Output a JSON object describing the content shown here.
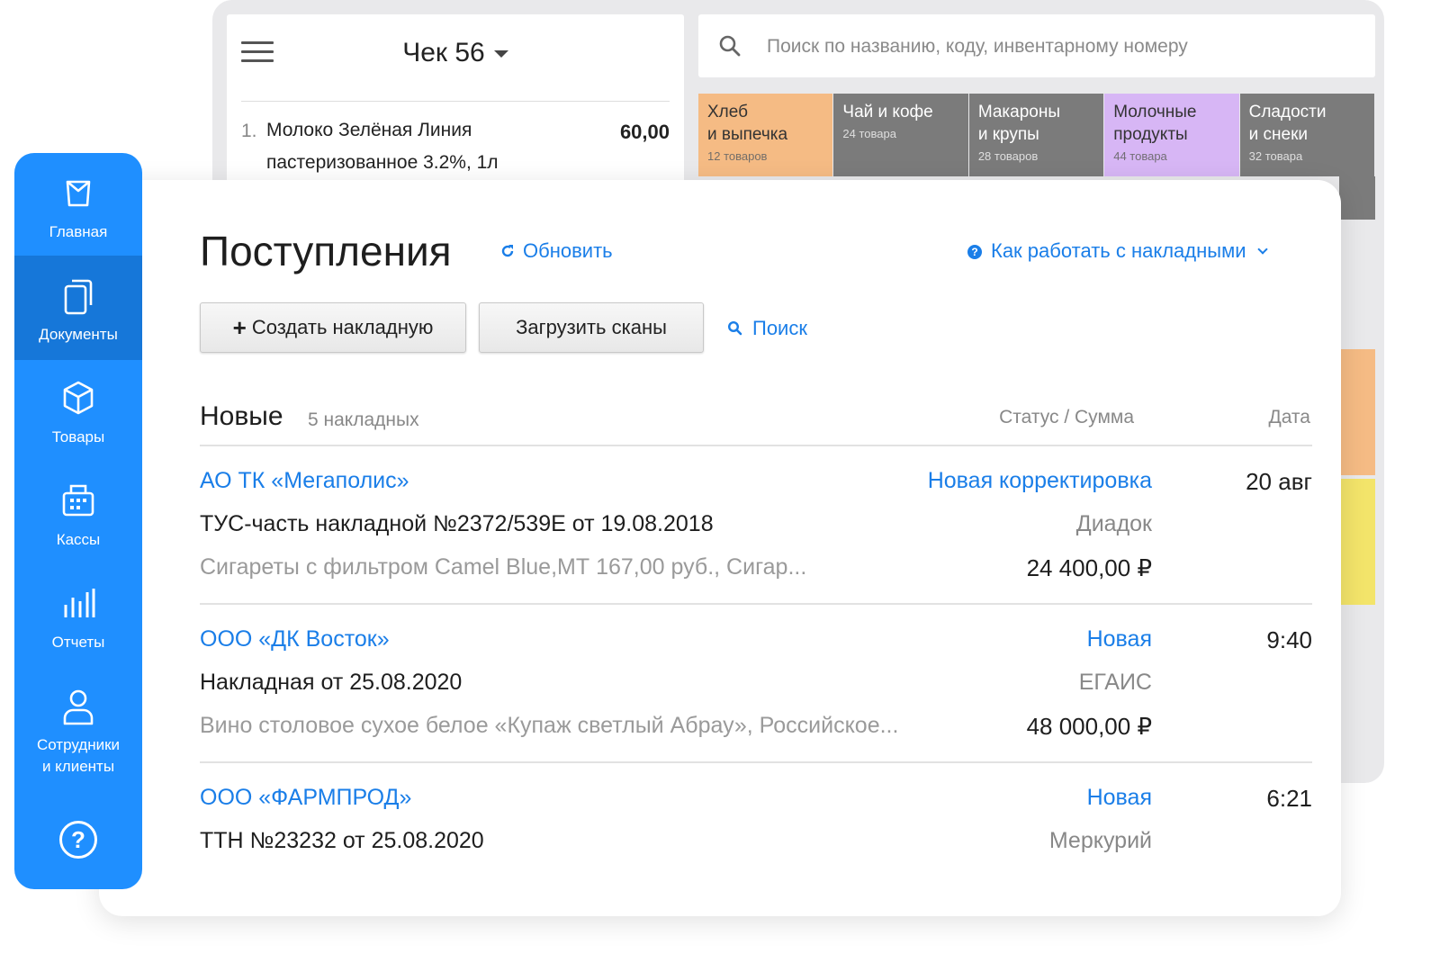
{
  "pos": {
    "check_title": "Чек 56",
    "receipt_item": {
      "num": "1.",
      "name": "Молоко Зелёная Линия пастеризованное 3.2%, 1л",
      "price": "60,00"
    },
    "search_placeholder": "Поиск по названию, коду, инвентарному номеру",
    "categories": [
      {
        "name": "Хлеб\nи выпечка",
        "count": "12 товаров",
        "color": "#f5bb84"
      },
      {
        "name": "Чай и кофе",
        "count": "24 товара",
        "color": "#7b7b7b"
      },
      {
        "name": "Макароны\nи крупы",
        "count": "28 товаров",
        "color": "#7b7b7b"
      },
      {
        "name": "Молочные\nпродукты",
        "count": "44 товара",
        "color": "#d7b6f5"
      },
      {
        "name": "Сладости\nи снеки",
        "count": "32 товара",
        "color": "#7b7b7b"
      }
    ],
    "strip_colors": [
      "#7b7b7b",
      "#f5bb84",
      "#f3e46a"
    ]
  },
  "sidebar": {
    "items": [
      {
        "label": "Главная",
        "icon": "bag-icon"
      },
      {
        "label": "Документы",
        "icon": "documents-icon",
        "active": true
      },
      {
        "label": "Товары",
        "icon": "box-icon"
      },
      {
        "label": "Кассы",
        "icon": "register-icon"
      },
      {
        "label": "Отчеты",
        "icon": "bar-chart-icon"
      },
      {
        "label": "Сотрудники\nи клиенты",
        "icon": "person-icon"
      }
    ],
    "help": "?"
  },
  "main": {
    "title": "Поступления",
    "refresh_label": "Обновить",
    "howto_label": "Как работать с накладными",
    "create_label": "Создать накладную",
    "upload_label": "Загрузить сканы",
    "search_label": "Поиск",
    "list_title": "Новые",
    "list_count": "5 накладных",
    "col_status": "Статус / Сумма",
    "col_date": "Дата",
    "rows": [
      {
        "supplier": "АО ТК «Мегаполис»",
        "status": "Новая корректировка",
        "date": "20 авг",
        "doc": "ТУС-часть накладной №2372/539Е от 19.08.2018",
        "source": "Диадок",
        "items": "Сигареты с фильтром Camel Blue,МТ 167,00 руб., Сигар...",
        "sum": "24 400,00 ₽"
      },
      {
        "supplier": "ООО «ДК Восток»",
        "status": "Новая",
        "date": "9:40",
        "doc": "Накладная от 25.08.2020",
        "source": "ЕГАИС",
        "items": "Вино столовое сухое белое «Купаж светлый Абрау», Российское...",
        "sum": "48 000,00 ₽"
      },
      {
        "supplier": "ООО «ФАРМПРОД»",
        "status": "Новая",
        "date": "6:21",
        "doc": "ТТН №23232 от 25.08.2020",
        "source": "Меркурий"
      }
    ]
  }
}
